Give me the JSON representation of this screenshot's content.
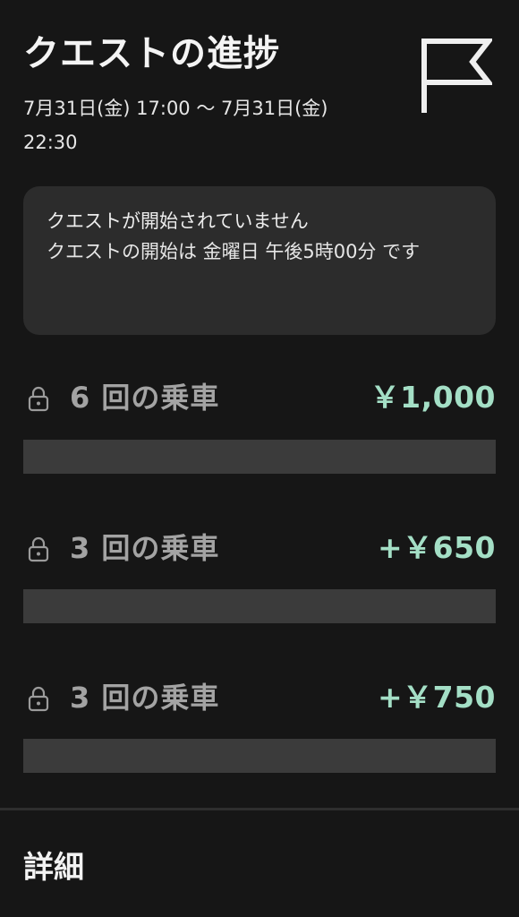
{
  "header": {
    "title": "クエストの進捗",
    "period": "7月31日(金) 17:00 〜 7月31日(金) 22:30",
    "icon": "flag-icon"
  },
  "notice": {
    "title": "クエストが開始されていません",
    "message": "クエストの開始は 金曜日 午後5時00分 です"
  },
  "quests": [
    {
      "label": "6 回の乗車",
      "amount": "￥1,000",
      "locked": true,
      "progress": 0
    },
    {
      "label": "3 回の乗車",
      "amount": "+￥650",
      "locked": true,
      "progress": 0
    },
    {
      "label": "3 回の乗車",
      "amount": "+￥750",
      "locked": true,
      "progress": 0
    }
  ],
  "details": {
    "heading": "詳細"
  },
  "colors": {
    "background": "#161616",
    "card": "#2c2c2c",
    "accent": "#a4dfc6",
    "track": "#3b3b3b",
    "muted_text": "#a3a3a3"
  }
}
